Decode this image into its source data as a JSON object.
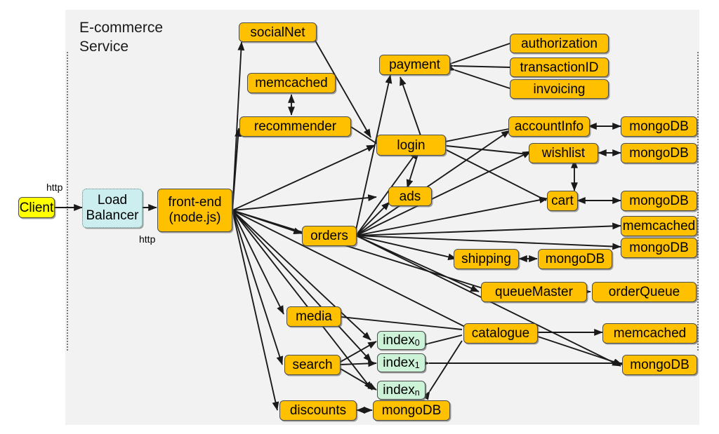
{
  "diagram": {
    "title": "E-commerce\nService",
    "boundary_name": "service-boundary",
    "colors": {
      "panel": "#f2f2f2",
      "service": "#ffc000",
      "client": "#ffff00",
      "load_balancer": "#cceeee",
      "index": "#ccf2d8",
      "edge": "#1a1a1a"
    }
  },
  "nodes": {
    "client": "Client",
    "load_balancer": "Load\nBalancer",
    "front_end": "front-end\n(node.js)",
    "social_net": "socialNet",
    "memcached_recommender": "memcached",
    "recommender": "recommender",
    "payment": "payment",
    "authorization": "authorization",
    "transaction_id": "transactionID",
    "invoicing": "invoicing",
    "login": "login",
    "ads": "ads",
    "orders": "orders",
    "account_info": "accountInfo",
    "account_info_db": "mongoDB",
    "wishlist": "wishlist",
    "wishlist_db": "mongoDB",
    "cart": "cart",
    "cart_db": "mongoDB",
    "orders_memcached": "memcached",
    "orders_db": "mongoDB",
    "shipping": "shipping",
    "shipping_db": "mongoDB",
    "queue_master": "queueMaster",
    "order_queue": "orderQueue",
    "media": "media",
    "search": "search",
    "index_0": "index",
    "index_0_sub": "0",
    "index_1": "index",
    "index_1_sub": "1",
    "index_n": "index",
    "index_n_sub": "n",
    "index_ellipsis": "…",
    "catalogue": "catalogue",
    "catalogue_memcached": "memcached",
    "catalogue_db": "mongoDB",
    "discounts": "discounts",
    "discounts_db": "mongoDB"
  },
  "edge_labels": {
    "client_to_lb": "http",
    "lb_to_frontend": "http"
  }
}
